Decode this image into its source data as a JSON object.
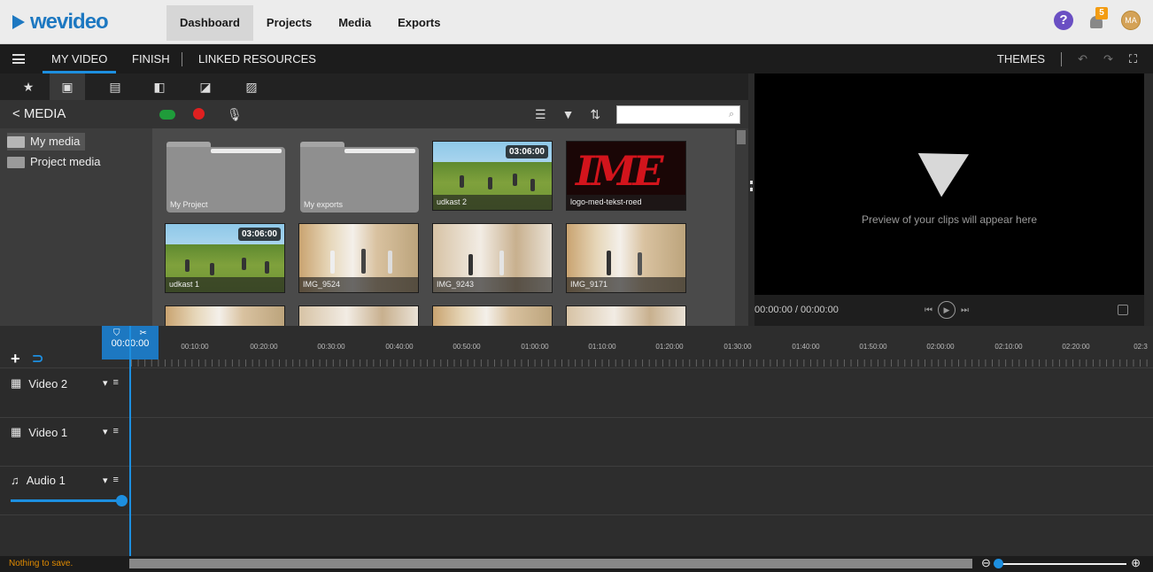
{
  "app": {
    "logo": "wevideo"
  },
  "nav": {
    "items": [
      "Dashboard",
      "Projects",
      "Media",
      "Exports"
    ],
    "active": "Dashboard"
  },
  "topright": {
    "help": "?",
    "notifications": "5",
    "avatar": "MA"
  },
  "secondary": {
    "tabs": [
      "MY VIDEO",
      "FINISH",
      "LINKED RESOURCES"
    ],
    "themes": "THEMES"
  },
  "media": {
    "back": "< MEDIA",
    "tree": [
      "My media",
      "Project media"
    ],
    "tiles": [
      {
        "label": "My Project",
        "kind": "folder"
      },
      {
        "label": "My exports",
        "kind": "folder"
      },
      {
        "label": "udkast 2",
        "kind": "field",
        "duration": "03:06:00"
      },
      {
        "label": "logo-med-tekst-roed",
        "kind": "logo",
        "logo_text": "IME"
      },
      {
        "label": "udkast 1",
        "kind": "field",
        "duration": "03:06:00"
      },
      {
        "label": "IMG_9524",
        "kind": "gym"
      },
      {
        "label": "IMG_9243",
        "kind": "gym"
      },
      {
        "label": "IMG_9171",
        "kind": "gym"
      }
    ]
  },
  "preview": {
    "message": "Preview of your clips will appear here",
    "time": "00:00:00 / 00:00:00"
  },
  "timeline": {
    "playhead": "00:00:00",
    "ruler": [
      "00:10:00",
      "00:20:00",
      "00:30:00",
      "00:40:00",
      "00:50:00",
      "01:00:00",
      "01:10:00",
      "01:20:00",
      "01:30:00",
      "01:40:00",
      "01:50:00",
      "02:00:00",
      "02:10:00",
      "02:20:00",
      "02:3"
    ],
    "tracks": [
      "Video 2",
      "Video 1",
      "Audio 1"
    ]
  },
  "status": {
    "text": "Nothing to save."
  },
  "colors": {
    "accent": "#1d78c1",
    "record": "#e02020",
    "upload": "#1f9c3a",
    "status": "#e08a00"
  }
}
